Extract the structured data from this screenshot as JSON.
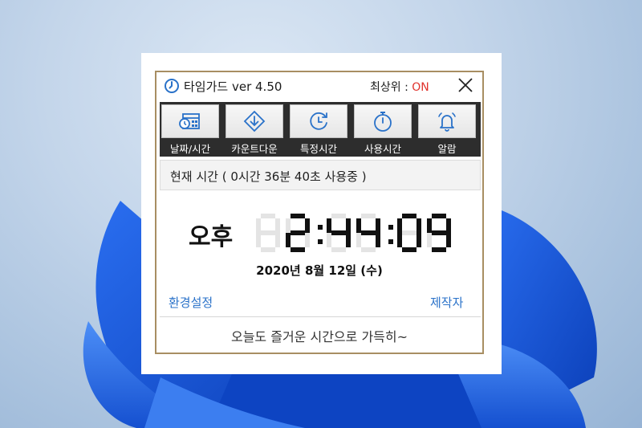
{
  "window": {
    "title": "타임가드 ver 4.50",
    "topmost_label": "최상위 : ",
    "topmost_value": "ON",
    "close_icon": "close-icon"
  },
  "toolbar": {
    "items": [
      {
        "label": "날짜/시간",
        "icon": "calendar-clock-icon"
      },
      {
        "label": "카운트다운",
        "icon": "countdown-arrow-icon"
      },
      {
        "label": "특정시간",
        "icon": "clock-refresh-icon"
      },
      {
        "label": "사용시간",
        "icon": "stopwatch-icon"
      },
      {
        "label": "알람",
        "icon": "bell-icon"
      }
    ]
  },
  "status": {
    "text": "현재 시간 ( 0시간 36분 40초 사용중 )"
  },
  "clock": {
    "ampm": "오후",
    "time": "2:44:09",
    "date": "2020년  8월 12일 (수)"
  },
  "links": {
    "settings": "환경설정",
    "author": "제작자"
  },
  "footer": {
    "message": "오늘도 즐거운 시간으로 가득히~"
  },
  "colors": {
    "accent_link": "#2a72c9",
    "on_red": "#e0322c",
    "frame_border": "#a88e62",
    "toolbar_bg": "#2d2d2d"
  }
}
